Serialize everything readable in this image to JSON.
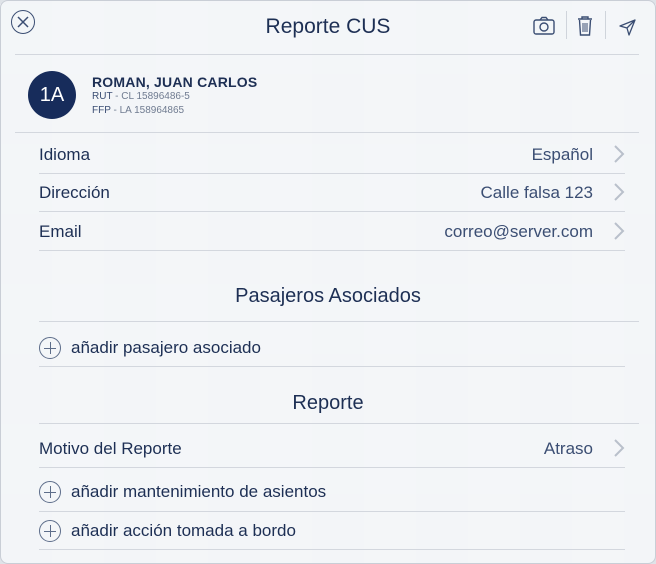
{
  "header": {
    "title": "Reporte CUS",
    "icons": [
      "close-icon",
      "camera-icon",
      "trash-icon",
      "send-icon"
    ]
  },
  "passenger": {
    "seat": "1A",
    "name": "ROMAN, JUAN CARLOS",
    "rut_label": "RUT",
    "rut_value": "- CL 15896486-5",
    "ffp_label": "FFP",
    "ffp_value": "- LA 158964865"
  },
  "details": [
    {
      "label": "Idioma",
      "value": "Español"
    },
    {
      "label": "Dirección",
      "value": "Calle falsa 123"
    },
    {
      "label": "Email",
      "value": "correo@server.com"
    }
  ],
  "associated": {
    "title": "Pasajeros Asociados",
    "add_label": "añadir pasajero asociado"
  },
  "report": {
    "title": "Reporte",
    "reason_label": "Motivo del Reporte",
    "reason_value": "Atraso",
    "add_maintenance_label": "añadir mantenimiento de asientos",
    "add_action_label": "añadir acción tomada a bordo"
  },
  "colors": {
    "primary": "#1d2f54",
    "avatar_bg": "#172c5b",
    "secondary_text": "#3b4e73"
  }
}
